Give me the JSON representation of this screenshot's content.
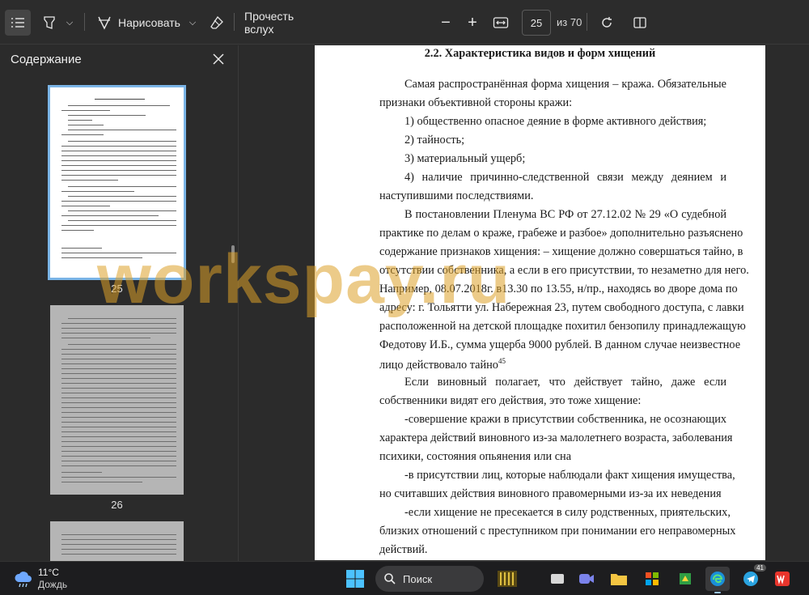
{
  "toolbar": {
    "draw_label": "Нарисовать",
    "read_aloud_label": "Прочесть вслух",
    "zoom_out_label": "−",
    "zoom_in_label": "+",
    "page_current": "25",
    "page_total": "из 70",
    "chevron": "⌵"
  },
  "sidebar": {
    "title": "Содержание",
    "thumbnails": [
      {
        "label": "25"
      },
      {
        "label": "26"
      }
    ]
  },
  "document": {
    "heading": "2.2. Характеристика видов и форм хищений",
    "lines": [
      "Самая распространённая форма хищения – кража. Обязательные",
      "признаки объективной стороны кражи:",
      "1) общественно опасное деяние в форме активного действия;",
      "2) тайность;",
      "3) материальный ущерб;",
      "4) наличие причинно-следственной связи между деянием и",
      "наступившими последствиями.",
      "В постановлении Пленума ВС РФ от 27.12.02 № 29 «О судебной",
      "практике по делам о краже, грабеже и разбое» дополнительно разъяснено",
      "содержание признаков хищения: – хищение должно совершаться тайно, в",
      "отсутствии собственника, а если в его присутствии, то незаметно для него.",
      "Например, 08.07.2018г. в13.30 по 13.55, н/пр., находясь во дворе дома по",
      "адресу: г. Тольятти ул. Набережная 23, путем свободного доступа, с лавки",
      "расположенной на детской площадке похитил бензопилу принадлежащую",
      "Федотову И.Б., сумма ущерба 9000 рублей. В данном случае неизвестное",
      "лицо действовало тайно",
      "Если виновный полагает, что действует тайно, даже если",
      "собственники видят его действия, это тоже хищение:",
      "-совершение кражи в присутствии собственника, не осознающих",
      "характера действий виновного из-за малолетнего возраста, заболевания",
      "психики, состояния опьянения или сна",
      "-в присутствии лиц, которые наблюдали факт хищения имущества,",
      "но считавших действия виновного правомерными из-за их неведения",
      "-если хищение не пресекается в силу родственных, приятельских,",
      "близких отношений с преступником при понимании его неправомерных",
      "действий."
    ],
    "footnote_ref": "45"
  },
  "watermark": "workspay.ru",
  "taskbar": {
    "temperature": "11°C",
    "weather": "Дождь",
    "search_label": "Поиск",
    "telegram_badge": "41"
  }
}
